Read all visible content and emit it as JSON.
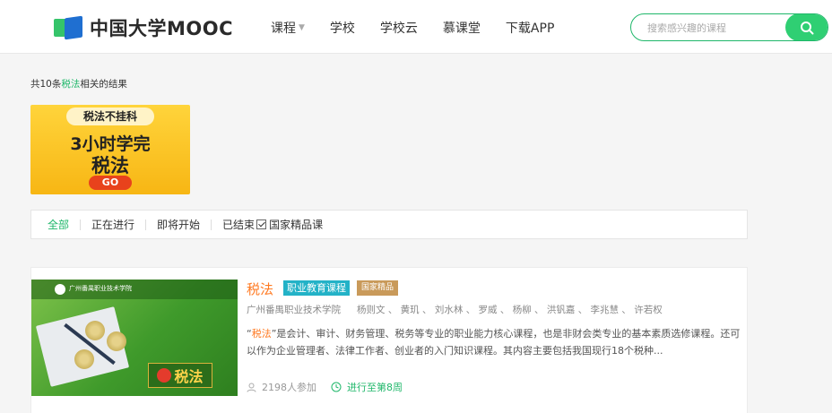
{
  "header": {
    "logo_text": "中国大学MOOC",
    "nav": [
      {
        "label": "课程",
        "has_dropdown": true
      },
      {
        "label": "学校"
      },
      {
        "label": "学校云"
      },
      {
        "label": "慕课堂"
      },
      {
        "label": "下载APP"
      }
    ],
    "search": {
      "placeholder": "搜索感兴趣的课程",
      "icon": "search-icon",
      "accent": "#2fcf73"
    }
  },
  "results": {
    "prefix": "共10条",
    "keyword": "税法",
    "suffix": "相关的结果"
  },
  "banner": {
    "tag": "税法不挂科",
    "line2": "3小时学完",
    "line3": "税法",
    "go": "GO"
  },
  "filters": {
    "items": [
      {
        "label": "全部",
        "active": true
      },
      {
        "label": "正在进行",
        "active": false
      },
      {
        "label": "即将开始",
        "active": false
      },
      {
        "label": "已结束",
        "active": false
      }
    ],
    "checkbox": {
      "label": "国家精品课",
      "checked": true
    }
  },
  "course": {
    "thumb_school": "广州番禺职业技术学院",
    "thumb_title": "税法",
    "title": "税法",
    "category_badge": "职业教育课程",
    "national_badge": "国家精品",
    "school": "广州番禺职业技术学院",
    "teachers": "杨则文 、 黄玑 、 刘水林 、 罗威 、 杨柳 、 洪钒嘉 、 李兆慧 、 许若权",
    "desc_kw": "税法",
    "desc_q1": "“",
    "desc_q2": "”",
    "desc_rest": "是会计、审计、财务管理、税务等专业的职业能力核心课程，也是非财会类专业的基本素质选修课程。还可以作为企业管理者、法律工作者、创业者的入门知识课程。其内容主要包括我国现行18个税种...",
    "participants": "2198人参加",
    "progress": "进行至第8周"
  },
  "colors": {
    "brand_green": "#1fb76a",
    "title_orange": "#ff7a22"
  }
}
